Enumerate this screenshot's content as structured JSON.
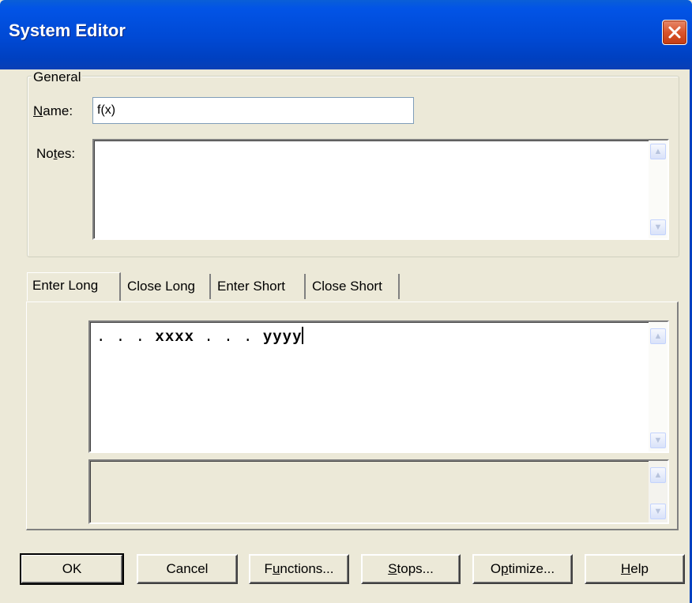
{
  "window": {
    "title": "System Editor"
  },
  "general": {
    "legend": "General",
    "name_label_mnemonic": "N",
    "name_label_rest": "ame:",
    "name_value": "f(x)",
    "notes_label_pre": "No",
    "notes_label_mnemonic": "t",
    "notes_label_post": "es:",
    "notes_value": ""
  },
  "tabs": [
    {
      "label": "Enter Long",
      "active": true
    },
    {
      "label": "Close Long",
      "active": false
    },
    {
      "label": "Enter Short",
      "active": false
    },
    {
      "label": "Close Short",
      "active": false
    }
  ],
  "editor": {
    "seg1": ". . . ",
    "seg2": "xxxx",
    "seg3": " . . . ",
    "seg4": "yyyy"
  },
  "buttons": {
    "ok": "OK",
    "cancel": "Cancel",
    "functions_pre": "F",
    "functions_mnemonic": "u",
    "functions_post": "nctions...",
    "stops_mnemonic": "S",
    "stops_post": "tops...",
    "optimize_pre": "O",
    "optimize_mnemonic": "p",
    "optimize_post": "timize...",
    "help_mnemonic": "H",
    "help_post": "elp"
  },
  "icons": {
    "close": "close-icon",
    "scroll_up": "scroll-up-icon",
    "scroll_down": "scroll-down-icon"
  },
  "colors": {
    "titlebar": "#0049d4",
    "dialog_bg": "#ece9d8",
    "close_button": "#d9542b"
  }
}
